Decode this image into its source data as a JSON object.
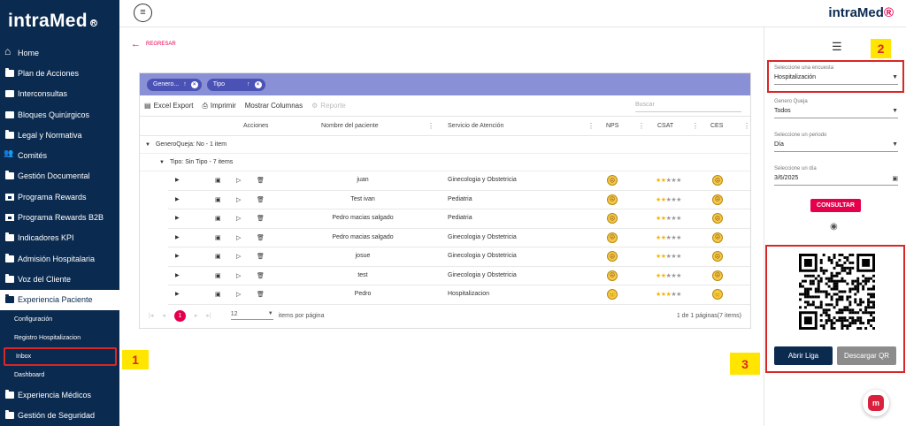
{
  "sidebar": {
    "brand": "intraMed",
    "brand_mark": "R",
    "items": [
      {
        "label": "Home",
        "icon": "home-icon"
      },
      {
        "label": "Plan de Acciones",
        "icon": "folder-icon"
      },
      {
        "label": "Interconsultas",
        "icon": "briefcase-icon"
      },
      {
        "label": "Bloques Quirúrgicos",
        "icon": "bed-icon"
      },
      {
        "label": "Legal y Normativa",
        "icon": "folder-icon"
      },
      {
        "label": "Comités",
        "icon": "group-icon"
      },
      {
        "label": "Gestión Documental",
        "icon": "folder-icon"
      },
      {
        "label": "Programa Rewards",
        "icon": "monitor-icon"
      },
      {
        "label": "Programa Rewards B2B",
        "icon": "monitor-icon"
      },
      {
        "label": "Indicadores KPI",
        "icon": "folder-icon"
      },
      {
        "label": "Admisión Hospitalaria",
        "icon": "folder-icon"
      },
      {
        "label": "Voz del Cliente",
        "icon": "folder-icon"
      },
      {
        "label": "Experiencia Paciente",
        "icon": "folder-icon"
      }
    ],
    "sub_items": [
      "Configuración",
      "Registro Hospitalizacion",
      "Inbox",
      "Dashboard"
    ],
    "bottom_items": [
      {
        "label": "Experiencia Médicos",
        "icon": "folder-icon"
      },
      {
        "label": "Gestión de Seguridad",
        "icon": "folder-icon"
      }
    ]
  },
  "topbar": {
    "logo_main": "intraMed",
    "logo_accent": "®"
  },
  "back_label": "REGRESAR",
  "grid": {
    "chips": [
      {
        "label": "Genero...",
        "arrow": "↑",
        "x": "×"
      },
      {
        "label": "Tipo",
        "arrow": "↑",
        "x": "×"
      }
    ],
    "toolbar": {
      "excel": "Excel Export",
      "print": "Imprimir",
      "columns": "Mostrar Columnas",
      "report": "Reporte",
      "search_placeholder": "Buscar"
    },
    "headers": {
      "acciones": "Acciones",
      "nombre": "Nombre del paciente",
      "servicio": "Servicio de Atención",
      "nps": "NPS",
      "csat": "CSAT",
      "ces": "CES"
    },
    "group1": "GeneroQueja: No - 1 item",
    "group2": "Tipo: Sin Tipo - 7 items",
    "rows": [
      {
        "nombre": "juan",
        "servicio": "Ginecologia y Obstetricia",
        "nps": "sad",
        "csat": 2,
        "ces": "sad"
      },
      {
        "nombre": "Test ivan",
        "servicio": "Pediatria",
        "nps": "sad",
        "csat": 2,
        "ces": "sad"
      },
      {
        "nombre": "Pedro macias salgado",
        "servicio": "Pediatria",
        "nps": "sad",
        "csat": 2,
        "ces": "sad"
      },
      {
        "nombre": "Pedro macias salgado",
        "servicio": "Ginecologia y Obstetricia",
        "nps": "sad",
        "csat": 2,
        "ces": "sad"
      },
      {
        "nombre": "josue",
        "servicio": "Ginecologia y Obstetricia",
        "nps": "sad",
        "csat": 2,
        "ces": "sad"
      },
      {
        "nombre": "test",
        "servicio": "Ginecologia y Obstetricia",
        "nps": "sad",
        "csat": 2,
        "ces": "sad"
      },
      {
        "nombre": "Pedro",
        "servicio": "Hospitalizacion",
        "nps": "neutral",
        "csat": 3,
        "ces": "neutral"
      }
    ],
    "pager": {
      "current": "1",
      "page_size": "12",
      "items_label": "items por página",
      "summary": "1 de 1 páginas(7 items)"
    }
  },
  "panel": {
    "encuesta_label": "Seleccione una encuesta",
    "encuesta_value": "Hospitalización",
    "genero_label": "Genero Queja",
    "genero_value": "Todos",
    "periodo_label": "Seleccione un periodo",
    "periodo_value": "Día",
    "dia_label": "Seleccione un día",
    "dia_value": "3/6/2025",
    "consultar": "CONSULTAR",
    "abrir": "Abrir Liga",
    "descargar": "Descargar QR"
  },
  "badges": [
    "1",
    "2",
    "3"
  ]
}
